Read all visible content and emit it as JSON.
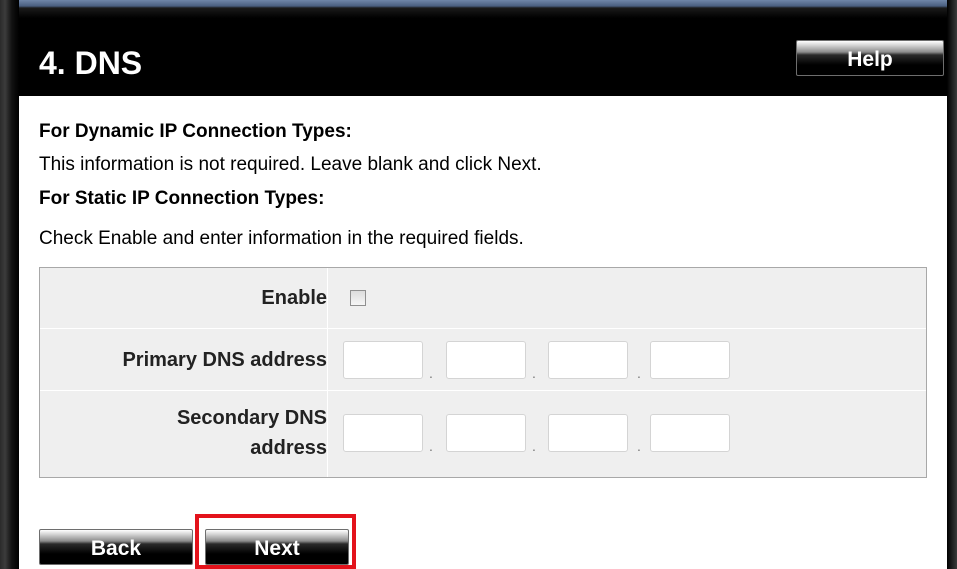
{
  "header": {
    "title": "4. DNS",
    "help_label": "Help"
  },
  "instructions": {
    "dynamic_heading": "For Dynamic IP Connection Types:",
    "dynamic_text": "This information is not required. Leave blank and click Next.",
    "static_heading": "For Static IP Connection Types:",
    "static_text": "Check Enable and enter information in the required fields."
  },
  "form": {
    "enable_label": "Enable",
    "enable_checked": false,
    "primary_label": "Primary DNS address",
    "secondary_label_line1": "Secondary DNS",
    "secondary_label_line2": "address",
    "primary_octets": [
      "",
      "",
      "",
      ""
    ],
    "secondary_octets": [
      "",
      "",
      "",
      ""
    ],
    "octet_separator": "."
  },
  "footer": {
    "back_label": "Back",
    "next_label": "Next"
  },
  "colors": {
    "title_bar": "#000000",
    "highlight": "#e3121b",
    "table_bg": "#efefef"
  }
}
